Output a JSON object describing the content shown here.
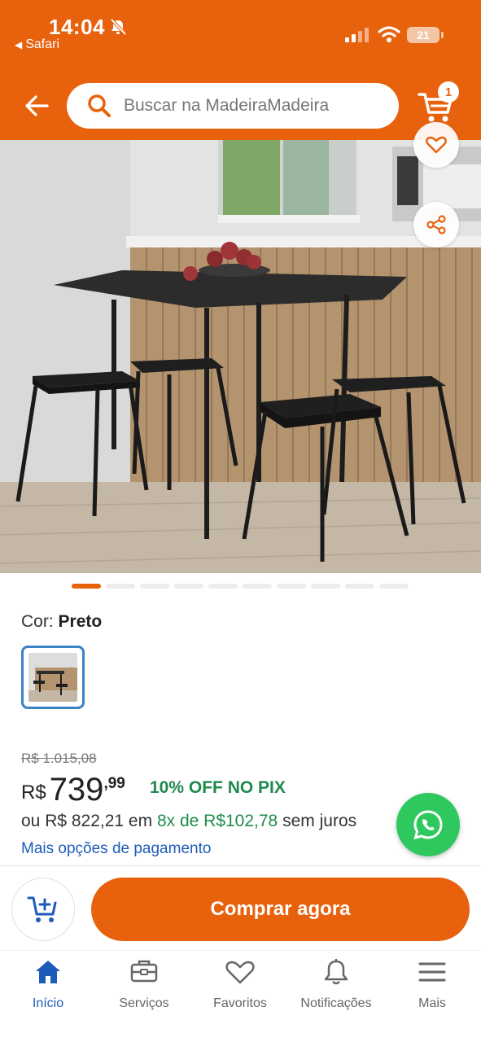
{
  "status_bar": {
    "time": "14:04",
    "back_app": "Safari",
    "battery": "21"
  },
  "header": {
    "search_placeholder": "Buscar na MadeiraMadeira",
    "cart_count": "1"
  },
  "gallery": {
    "slide_count": 10,
    "active_index": 0
  },
  "product": {
    "color_label": "Cor:",
    "color_value": "Preto",
    "old_price": "R$ 1.015,08",
    "price_currency": "R$",
    "price_integer": "739",
    "price_cents": ",99",
    "pix_discount": "10% OFF NO PIX",
    "installments_prefix": "ou R$ 822,21 em",
    "installments_plan": "8x de R$102,78",
    "installments_suffix": "sem juros",
    "more_payment_options": "Mais opções de pagamento"
  },
  "actions": {
    "buy_now": "Comprar agora"
  },
  "tabbar": {
    "items": [
      {
        "label": "Início",
        "icon": "home-icon",
        "active": true
      },
      {
        "label": "Serviços",
        "icon": "toolbox-icon",
        "active": false
      },
      {
        "label": "Favoritos",
        "icon": "heart-icon",
        "active": false
      },
      {
        "label": "Notificações",
        "icon": "bell-icon",
        "active": false
      },
      {
        "label": "Mais",
        "icon": "menu-icon",
        "active": false
      }
    ]
  },
  "colors": {
    "brand": "#e8620e",
    "link": "#1e5bb8",
    "success": "#1f8a4c",
    "whatsapp": "#2fc85f"
  }
}
